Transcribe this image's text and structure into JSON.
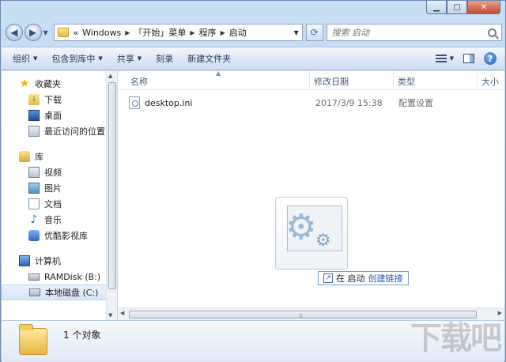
{
  "window": {
    "controls": {
      "minimize": "▁",
      "maximize": "▢",
      "close": "✕"
    }
  },
  "address": {
    "overflow": "«",
    "crumbs": [
      "Windows",
      "「开始」菜单",
      "程序",
      "启动"
    ],
    "search_placeholder": "搜索 启动"
  },
  "toolbar": {
    "organize": "组织",
    "include_in_library": "包含到库中",
    "share": "共享",
    "burn": "刻录",
    "new_folder": "新建文件夹"
  },
  "nav": {
    "favorites": "收藏夹",
    "downloads": "下载",
    "desktop": "桌面",
    "recent": "最近访问的位置",
    "libraries": "库",
    "videos": "视频",
    "pictures": "图片",
    "documents": "文档",
    "music": "音乐",
    "youku": "优酷影视库",
    "computer": "计算机",
    "ramdisk": "RAMDisk (B:)",
    "local_disk": "本地磁盘 (C:)"
  },
  "columns": {
    "name": "名称",
    "modified": "修改日期",
    "type": "类型",
    "size": "大小"
  },
  "files": [
    {
      "name": "desktop.ini",
      "modified": "2017/3/9 15:38",
      "type": "配置设置"
    }
  ],
  "drag_tip": {
    "prefix": "在 启动",
    "action": "创建链接"
  },
  "details": {
    "count": "1 个对象"
  },
  "watermark": "下载吧"
}
